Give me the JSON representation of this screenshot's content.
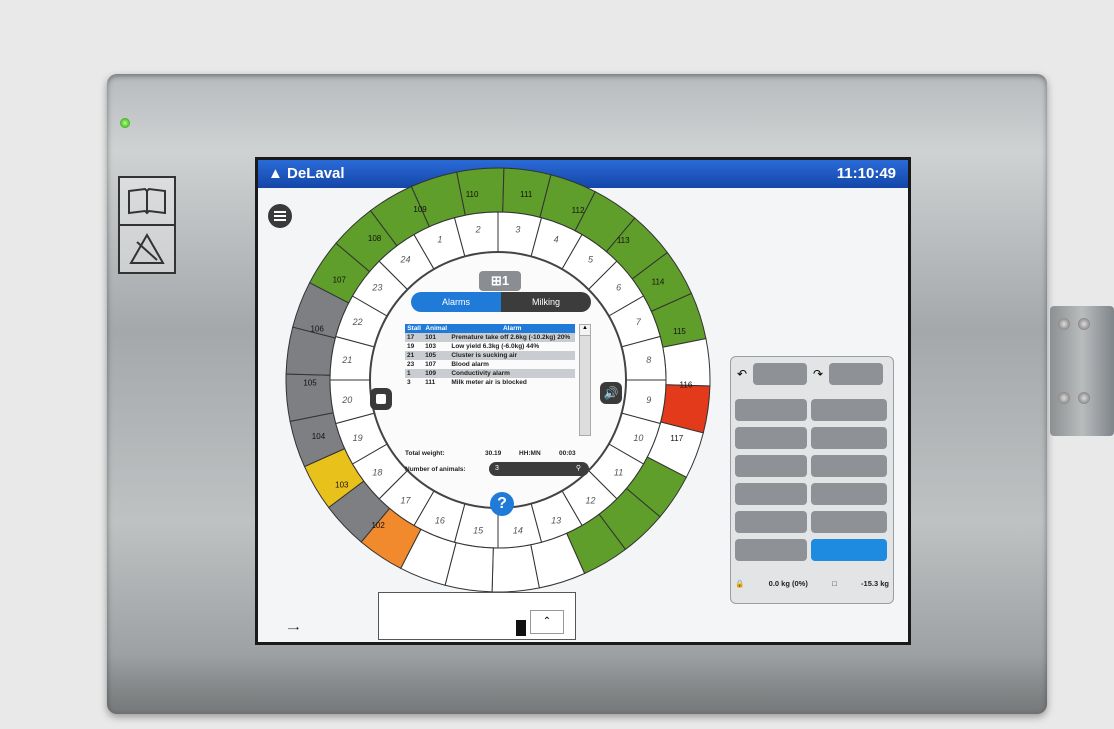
{
  "brand": "DeLaval",
  "clock": "11:10:49",
  "unit_badge": "1",
  "tabs": [
    {
      "label": "Alarms",
      "active": true
    },
    {
      "label": "Milking",
      "active": false
    }
  ],
  "alarm_table": {
    "headers": [
      "Stall",
      "Animal",
      "Alarm"
    ],
    "rows": [
      {
        "stall": "17",
        "animal": "101",
        "alarm": "Premature take off 2.6kg (-10.2kg) 20%"
      },
      {
        "stall": "19",
        "animal": "103",
        "alarm": "Low yield 6.3kg (-6.0kg) 44%"
      },
      {
        "stall": "21",
        "animal": "105",
        "alarm": "Cluster is sucking air"
      },
      {
        "stall": "23",
        "animal": "107",
        "alarm": "Blood alarm"
      },
      {
        "stall": "1",
        "animal": "109",
        "alarm": "Conductivity alarm"
      },
      {
        "stall": "3",
        "animal": "111",
        "alarm": "Milk meter air is blocked"
      }
    ]
  },
  "totals": {
    "label": "Total weight:",
    "value": "30.19",
    "time_label": "HH:MN",
    "time": "00:03"
  },
  "animals": {
    "label": "Number of animals:",
    "value": "3"
  },
  "help_icon": "?",
  "stall_numbers": [
    "1",
    "2",
    "3",
    "4",
    "5",
    "6",
    "7",
    "8",
    "9",
    "10",
    "11",
    "12",
    "13",
    "14",
    "15",
    "16",
    "17",
    "18",
    "19",
    "20",
    "21",
    "22",
    "23",
    "24"
  ],
  "outer_labels": [
    "102",
    "103",
    "104",
    "105",
    "106",
    "107",
    "108",
    "109",
    "110",
    "111",
    "112",
    "113",
    "114",
    "115",
    "116",
    "117"
  ],
  "weights": {
    "left": "0.0 kg (0%)",
    "right": "-15.3 kg"
  },
  "colors": {
    "green": "#5f9e2a",
    "gray": "#7d7f82",
    "yellow": "#e8c21a",
    "orange": "#f08a2c",
    "red": "#e23a1a",
    "blue": "#1f7ad8"
  }
}
